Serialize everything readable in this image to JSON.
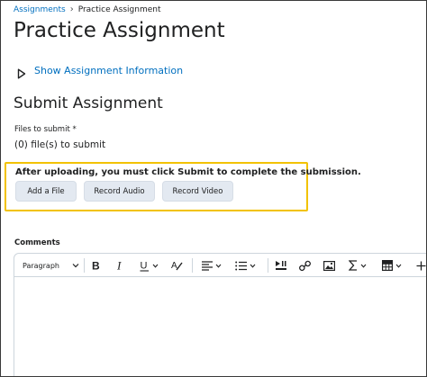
{
  "breadcrumb": {
    "link": "Assignments",
    "separator": "›",
    "current": "Practice Assignment"
  },
  "page_title": "Practice Assignment",
  "info_toggle_label": "Show Assignment Information",
  "submit_section": {
    "title": "Submit Assignment",
    "files_label": "Files to submit *",
    "files_count": "(0) file(s) to submit",
    "upload_note": "After uploading, you must click Submit to complete the submission.",
    "buttons": {
      "add_file": "Add a File",
      "record_audio": "Record Audio",
      "record_video": "Record Video"
    }
  },
  "comments": {
    "label": "Comments",
    "paragraph_style": "Paragraph"
  },
  "colors": {
    "link": "#006fbf",
    "highlight_border": "#f2c200",
    "button_bg": "#e3e9f1"
  },
  "icons": [
    "triangle-right-icon",
    "bold-icon",
    "italic-icon",
    "underline-icon",
    "text-color-icon",
    "align-icon",
    "list-icon",
    "media-icon",
    "link-icon",
    "image-icon",
    "equation-icon",
    "table-icon",
    "plus-icon",
    "chevron-down-icon"
  ]
}
